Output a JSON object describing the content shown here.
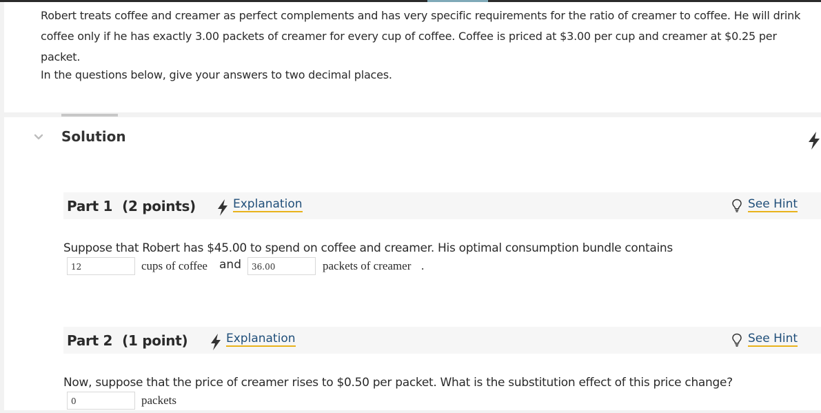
{
  "intro": {
    "paragraph1": "Robert treats coffee and creamer as perfect complements and has very specific requirements for the ratio of creamer to coffee. He will drink coffee only if he has exactly 3.00 packets of creamer for every cup of coffee. Coffee is priced at $3.00 per cup and creamer at $0.25 per packet.",
    "paragraph2": "In the questions below, give your answers to two decimal places."
  },
  "solution": {
    "title": "Solution"
  },
  "parts": [
    {
      "title": "Part 1",
      "points": "(2 points)",
      "explanation_label": "Explanation",
      "hint_label": "See Hint",
      "question": "Suppose that Robert has $45.00 to spend on coffee and creamer. His optimal consumption bundle contains",
      "answer1_value": "12",
      "answer1_unit": "cups of coffee",
      "conjunction": "and",
      "answer2_value": "36.00",
      "answer2_unit": "packets of creamer",
      "end_punct": "."
    },
    {
      "title": "Part 2",
      "points": "(1 point)",
      "explanation_label": "Explanation",
      "hint_label": "See Hint",
      "question": "Now, suppose that the price of creamer rises to $0.50 per packet. What is the substitution effect of this price change?",
      "answer1_value": "0",
      "answer1_unit": "packets"
    }
  ],
  "colors": {
    "link": "#1f4e79",
    "link_underline": "#e8b21a",
    "header_bg": "#f6f6f6"
  },
  "icons": [
    "chevron-down-icon",
    "lightning-bolt-icon",
    "lightbulb-icon"
  ]
}
